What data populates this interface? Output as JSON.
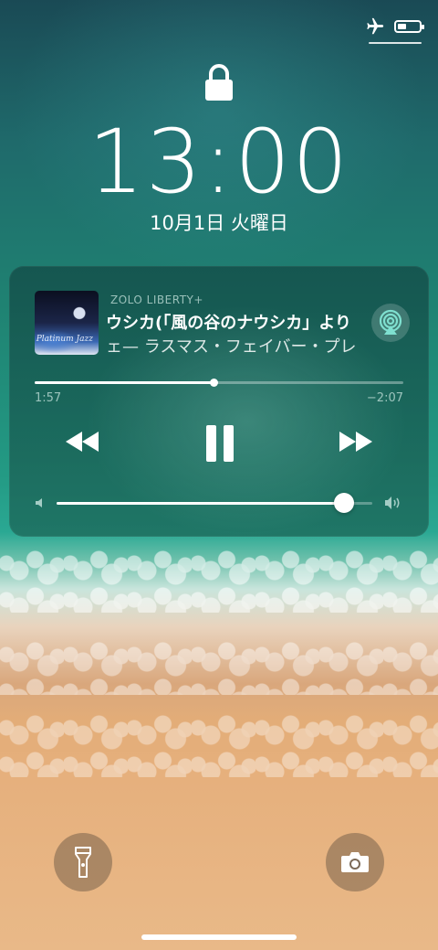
{
  "status_bar": {
    "airplane_icon": "airplane-icon",
    "battery_level": 0.35
  },
  "lock_screen": {
    "lock_icon": "lock-icon",
    "time": "13:00",
    "date": "10月1日 火曜日"
  },
  "now_playing": {
    "source": "ZOLO LIBERTY+",
    "title": "ウシカ(「風の谷のナウシカ」より",
    "artist": "ェ— ラスマス・フェイバー・プレ",
    "album_art_text": "Platinum Jazz",
    "elapsed": "1:57",
    "remaining": "−2:07",
    "progress": 0.485,
    "volume": 0.91,
    "controls": [
      "rewind-icon",
      "pause-icon",
      "fast-forward-icon"
    ],
    "airplay_icon": "airplay-icon"
  },
  "quick_actions": {
    "left": "flashlight-icon",
    "right": "camera-icon"
  }
}
